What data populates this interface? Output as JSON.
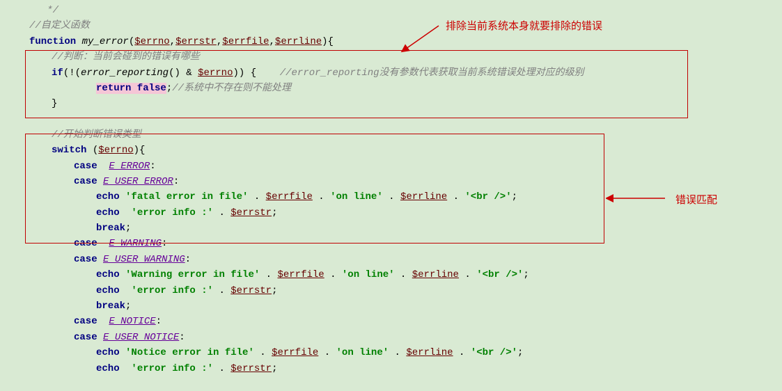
{
  "lines": {
    "l1": "   */",
    "l2": "//自定义函数",
    "l3_kw": "function",
    "l3_fn": " my_error",
    "l3_p1": "(",
    "l3_v1": "$errno",
    "l3_c1": ",",
    "l3_v2": "$errstr",
    "l3_c2": ",",
    "l3_v3": "$errfile",
    "l3_c3": ",",
    "l3_v4": "$errline",
    "l3_p2": "){",
    "l4": "//判断：当前会碰到的错误有哪些",
    "l5_kw": "if",
    "l5_p1": "(!(",
    "l5_fn": "error_reporting",
    "l5_p2": "() & ",
    "l5_v": "$errno",
    "l5_p3": ")) {",
    "l5_cm": "    //error_reporting没有参数代表获取当前系统错误处理对应的级别",
    "l6_kw": "return false",
    "l6_sc": ";",
    "l6_cm": "//系统中不存在则不能处理",
    "l7": "}",
    "l8": "//开始判断错误类型",
    "l9_kw": "switch ",
    "l9_p1": "(",
    "l9_v": "$errno",
    "l9_p2": "){",
    "l10_kw": "case  ",
    "l10_c": "E_ERROR",
    "l10_cl": ":",
    "l11_kw": "case ",
    "l11_c": "E_USER_ERROR",
    "l11_cl": ":",
    "l12_kw": "echo ",
    "l12_s1": "'fatal error in file'",
    "l12_d1": " . ",
    "l12_v1": "$errfile",
    "l12_d2": " . ",
    "l12_s2": "'on line'",
    "l12_d3": " . ",
    "l12_v2": "$errline",
    "l12_d4": " . ",
    "l12_s3": "'<br />'",
    "l12_sc": ";",
    "l13_kw": "echo  ",
    "l13_s1": "'error info :'",
    "l13_d1": " . ",
    "l13_v1": "$errstr",
    "l13_sc": ";",
    "l14_kw": "break",
    "l14_sc": ";",
    "l15_kw": "case  ",
    "l15_c": "E_WARNING",
    "l15_cl": ":",
    "l16_kw": "case ",
    "l16_c": "E_USER_WARNING",
    "l16_cl": ":",
    "l17_kw": "echo ",
    "l17_s1": "'Warning error in file'",
    "l17_d1": " . ",
    "l17_v1": "$errfile",
    "l17_d2": " . ",
    "l17_s2": "'on line'",
    "l17_d3": " . ",
    "l17_v2": "$errline",
    "l17_d4": " . ",
    "l17_s3": "'<br />'",
    "l17_sc": ";",
    "l18_kw": "echo  ",
    "l18_s1": "'error info :'",
    "l18_d1": " . ",
    "l18_v1": "$errstr",
    "l18_sc": ";",
    "l19_kw": "break",
    "l19_sc": ";",
    "l20_kw": "case  ",
    "l20_c": "E_NOTICE",
    "l20_cl": ":",
    "l21_kw": "case ",
    "l21_c": "E_USER_NOTICE",
    "l21_cl": ":",
    "l22_kw": "echo ",
    "l22_s1": "'Notice error in file'",
    "l22_d1": " . ",
    "l22_v1": "$errfile",
    "l22_d2": " . ",
    "l22_s2": "'on line'",
    "l22_d3": " . ",
    "l22_v2": "$errline",
    "l22_d4": " . ",
    "l22_s3": "'<br />'",
    "l22_sc": ";",
    "l23_kw": "echo  ",
    "l23_s1": "'error info :'",
    "l23_d1": " . ",
    "l23_v1": "$errstr",
    "l23_sc": ";"
  },
  "annotations": {
    "a1": "排除当前系统本身就要排除的错误",
    "a2": "错误匹配"
  }
}
